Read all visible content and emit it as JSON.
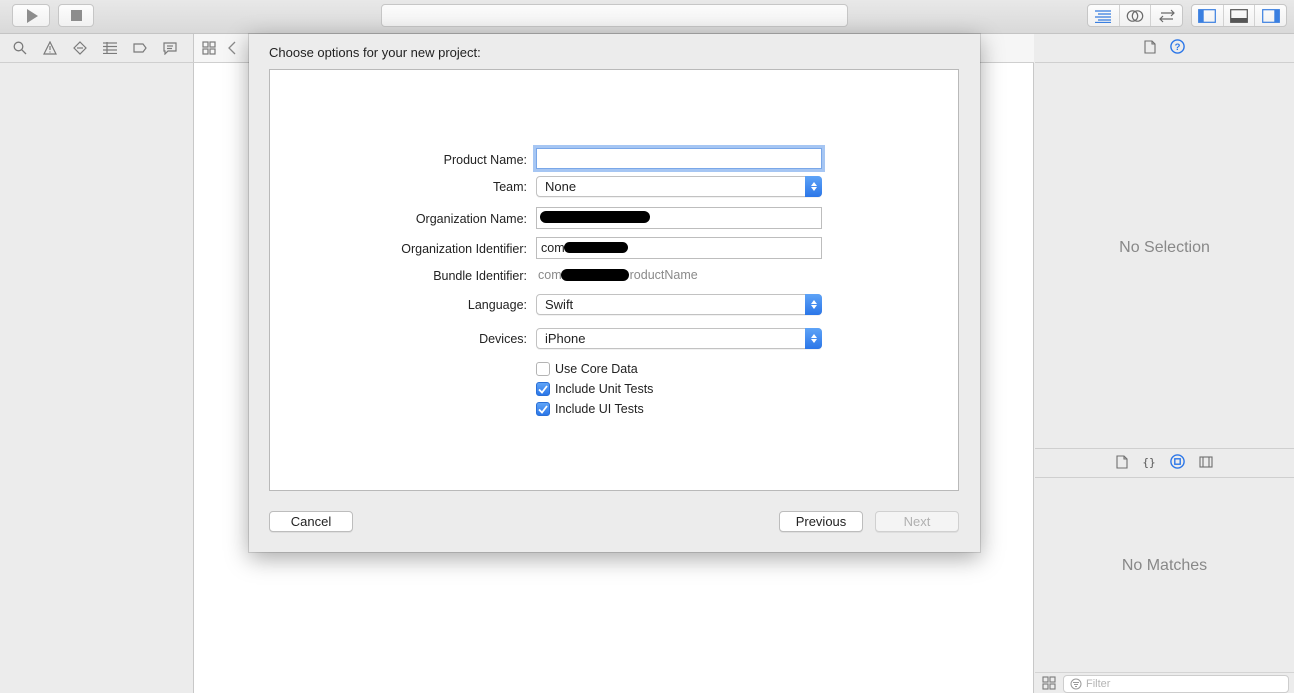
{
  "sheet": {
    "title": "Choose options for your new project:",
    "fields": {
      "product_name": {
        "label": "Product Name:",
        "value": ""
      },
      "team": {
        "label": "Team:",
        "value": "None"
      },
      "organization_name": {
        "label": "Organization Name:",
        "value": ""
      },
      "organization_identifier": {
        "label": "Organization Identifier:",
        "value": "com."
      },
      "bundle_identifier": {
        "label": "Bundle Identifier:",
        "value_prefix": "com",
        "value_suffix": "roductName"
      },
      "language": {
        "label": "Language:",
        "value": "Swift"
      },
      "devices": {
        "label": "Devices:",
        "value": "iPhone"
      }
    },
    "checkboxes": [
      {
        "label": "Use Core Data",
        "checked": false
      },
      {
        "label": "Include Unit Tests",
        "checked": true
      },
      {
        "label": "Include UI Tests",
        "checked": true
      }
    ],
    "buttons": {
      "cancel": "Cancel",
      "previous": "Previous",
      "next": "Next",
      "next_enabled": false
    }
  },
  "inspector": {
    "no_selection": "No Selection",
    "no_matches": "No Matches",
    "filter_placeholder": "Filter"
  },
  "colors": {
    "accent": "#2b76e8",
    "focus_ring": "#a6c6f3"
  },
  "icons": {
    "toolbar": [
      "run-icon",
      "stop-icon",
      "standard-editor-icon",
      "assistant-editor-icon",
      "version-editor-icon",
      "navigator-panel-icon",
      "debug-panel-icon",
      "utilities-panel-icon"
    ],
    "navigator": [
      "search-icon",
      "warning-icon",
      "breakpoint-icon",
      "list-icon",
      "tag-icon",
      "message-icon"
    ],
    "inspector": [
      "file-icon",
      "help-icon"
    ],
    "library": [
      "file-template-icon",
      "code-snippet-icon",
      "object-library-icon",
      "media-library-icon"
    ]
  }
}
